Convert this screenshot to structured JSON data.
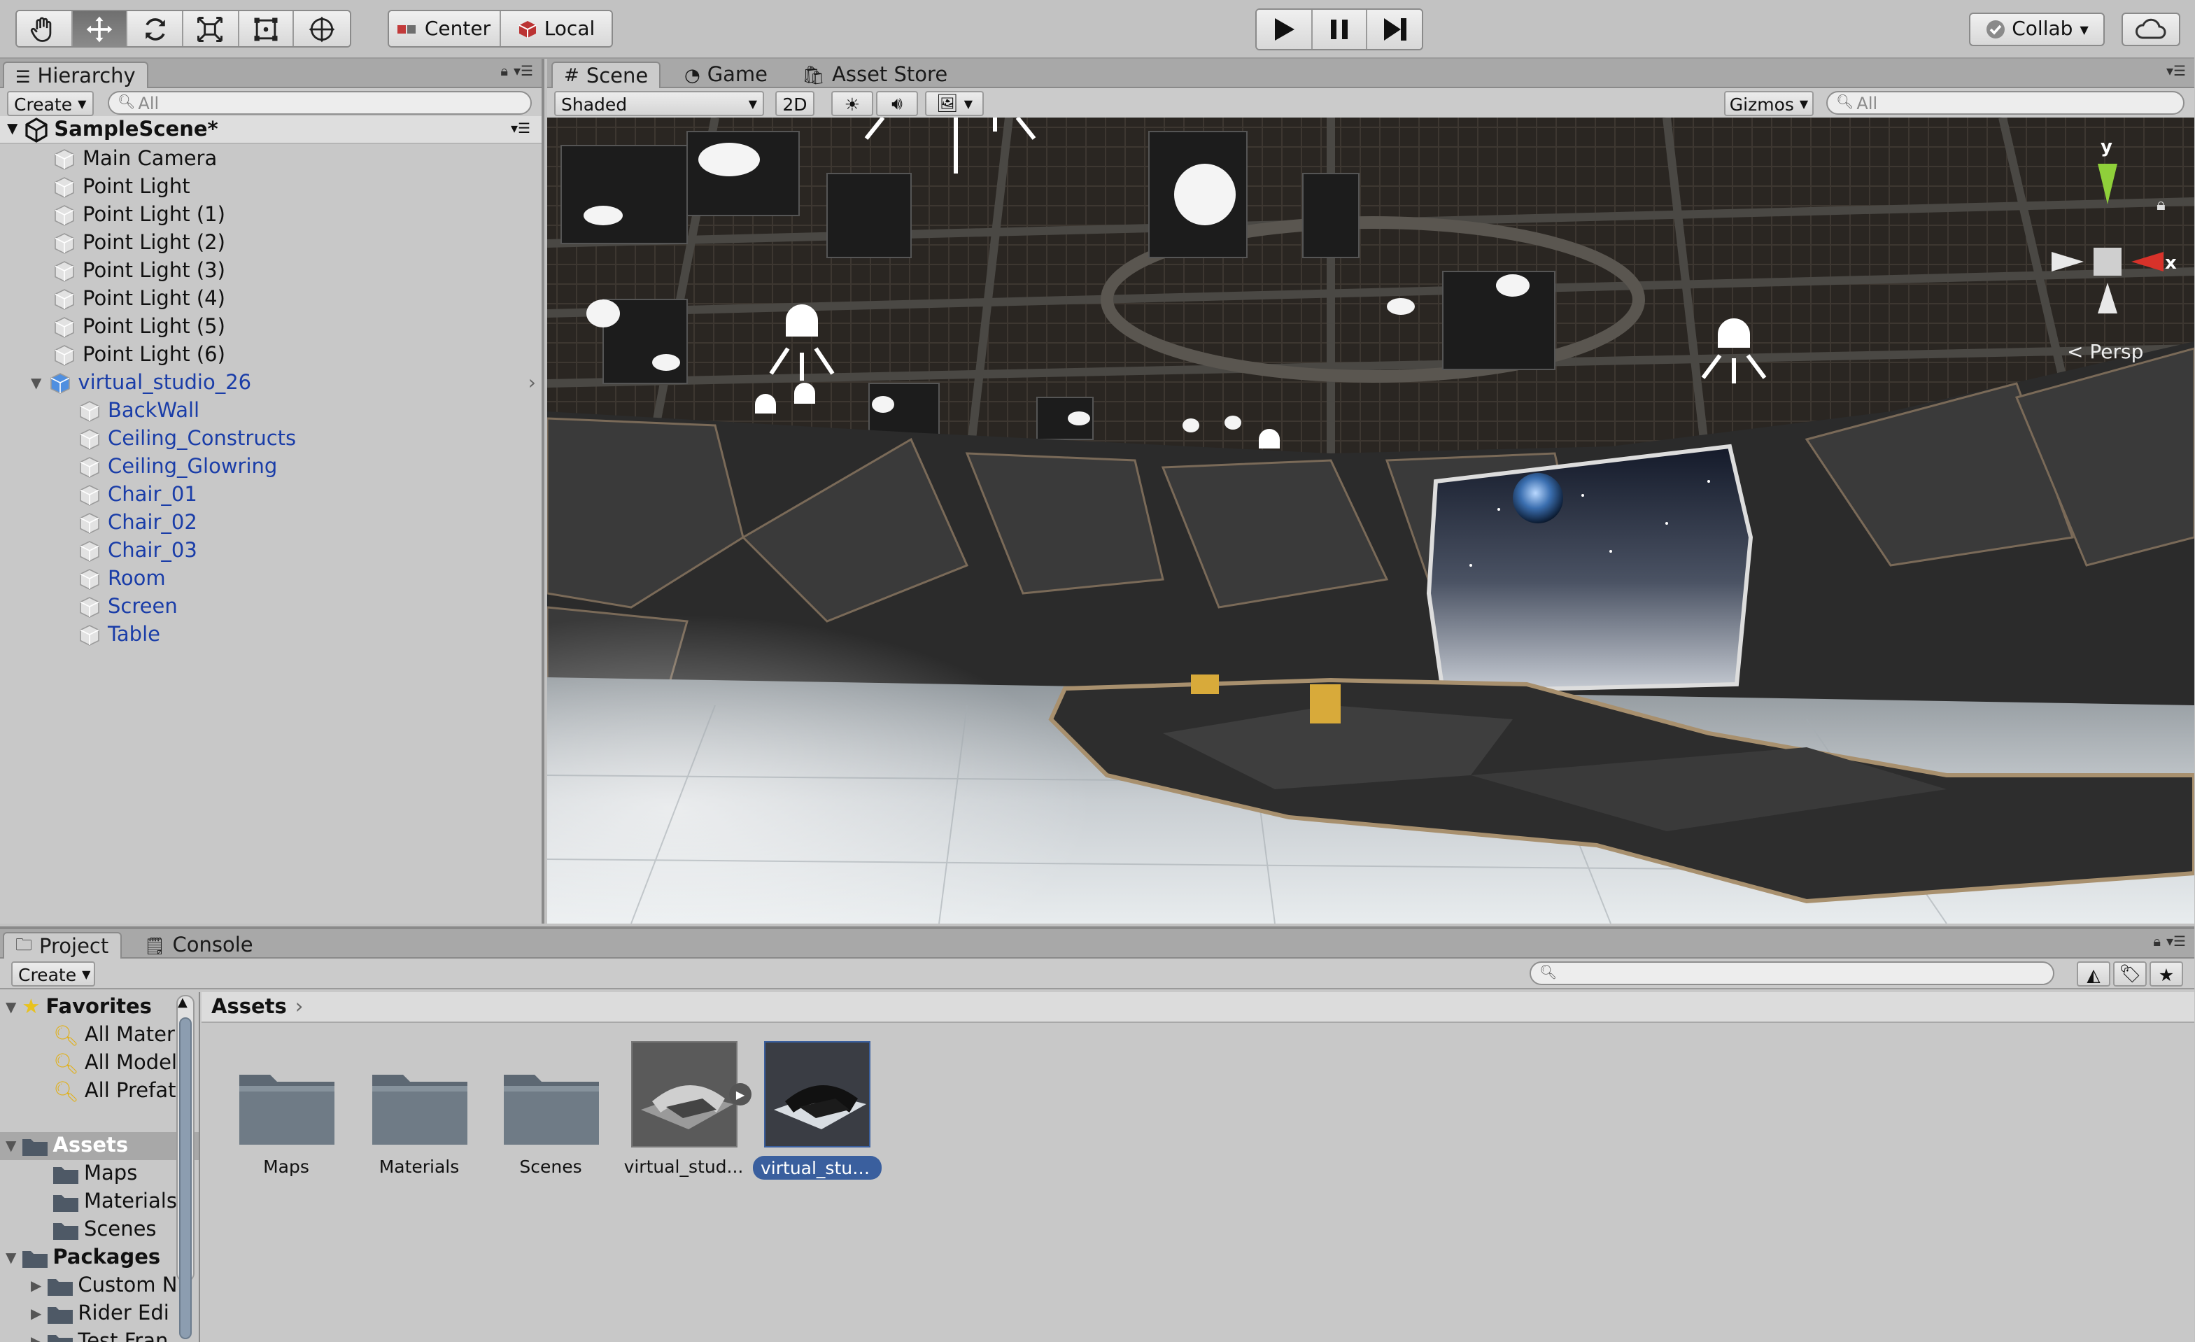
{
  "toolbar": {
    "tools": [
      "hand-tool",
      "move-tool",
      "rotate-tool",
      "scale-tool",
      "rect-tool",
      "transform-tool"
    ],
    "active_tool": "move-tool",
    "pivot_mode": "Center",
    "pivot_rotation": "Local",
    "play_controls": [
      "play",
      "pause",
      "step"
    ],
    "collab_label": "Collab"
  },
  "hierarchy": {
    "tab_label": "Hierarchy",
    "create_label": "Create",
    "search_placeholder": "All",
    "scene_name": "SampleScene*",
    "items": [
      {
        "label": "Main Camera"
      },
      {
        "label": "Point Light"
      },
      {
        "label": "Point Light (1)"
      },
      {
        "label": "Point Light (2)"
      },
      {
        "label": "Point Light (3)"
      },
      {
        "label": "Point Light (4)"
      },
      {
        "label": "Point Light (5)"
      },
      {
        "label": "Point Light (6)"
      },
      {
        "label": "virtual_studio_26"
      }
    ],
    "children": [
      {
        "label": "BackWall"
      },
      {
        "label": "Ceiling_Constructs"
      },
      {
        "label": "Ceiling_Glowring"
      },
      {
        "label": "Chair_01"
      },
      {
        "label": "Chair_02"
      },
      {
        "label": "Chair_03"
      },
      {
        "label": "Room"
      },
      {
        "label": "Screen"
      },
      {
        "label": "Table"
      }
    ]
  },
  "scene_view": {
    "tabs": [
      {
        "label": "Scene"
      },
      {
        "label": "Game"
      },
      {
        "label": "Asset Store"
      }
    ],
    "shading_mode": "Shaded",
    "mode_2d_label": "2D",
    "gizmos_label": "Gizmos",
    "search_placeholder": "All",
    "gizmo": {
      "y_label": "y",
      "x_label": "x",
      "projection": "Persp"
    }
  },
  "project": {
    "tabs": [
      {
        "label": "Project"
      },
      {
        "label": "Console"
      }
    ],
    "create_label": "Create",
    "favorites": {
      "label": "Favorites",
      "items": [
        {
          "label": "All Mater"
        },
        {
          "label": "All Model"
        },
        {
          "label": "All Prefat"
        }
      ]
    },
    "assets_tree": {
      "label": "Assets",
      "items": [
        {
          "label": "Maps"
        },
        {
          "label": "Materials"
        },
        {
          "label": "Scenes"
        }
      ]
    },
    "packages_tree": {
      "label": "Packages",
      "items": [
        {
          "label": "Custom N"
        },
        {
          "label": "Rider Edi"
        },
        {
          "label": "Test Fran"
        }
      ]
    },
    "breadcrumb": "Assets",
    "assets": [
      {
        "label": "Maps"
      },
      {
        "label": "Materials"
      },
      {
        "label": "Scenes"
      },
      {
        "label": "virtual_stud..."
      },
      {
        "label": "virtual_stud..."
      }
    ]
  },
  "colors": {
    "prefab_text": "#1a3da8",
    "selection": "#3a5f9e",
    "panel_bg": "#c8c8c8",
    "gizmo_y": "#8fd03a",
    "gizmo_x": "#d8322a"
  }
}
